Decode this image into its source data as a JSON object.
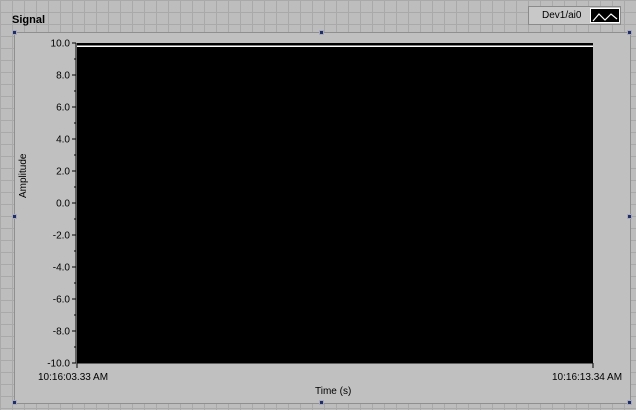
{
  "graph": {
    "label": "Signal",
    "legend": {
      "name": "Dev1/ai0"
    },
    "y_axis_title": "Amplitude",
    "x_axis_title": "Time (s)",
    "x_ticks": [
      "10:16:03.33 AM",
      "10:16:13.34 AM"
    ],
    "y_ticks": [
      "10.0",
      "8.0",
      "6.0",
      "4.0",
      "2.0",
      "0.0",
      "-2.0",
      "-4.0",
      "-6.0",
      "-8.0",
      "-10.0"
    ],
    "colors": {
      "plot_bg": "#000000",
      "trace": "#ffffff",
      "frame": "#c0c0c0"
    }
  },
  "chart_data": {
    "type": "line",
    "series": [
      {
        "name": "Dev1/ai0",
        "x": [
          "10:16:03.33 AM",
          "10:16:13.34 AM"
        ],
        "y": [
          9.8,
          9.8
        ]
      }
    ],
    "xlabel": "Time (s)",
    "ylabel": "Amplitude",
    "ylim": [
      -10,
      10
    ],
    "grid": false,
    "legend": "top-right"
  }
}
